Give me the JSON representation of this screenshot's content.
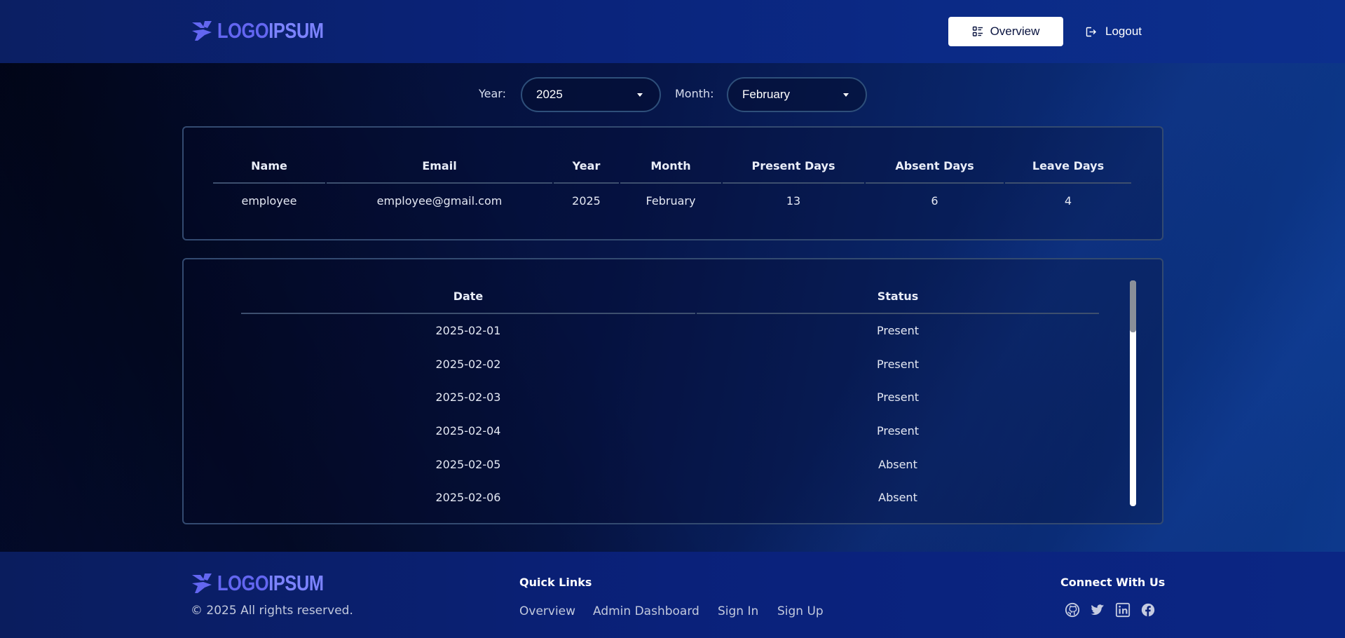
{
  "brand": {
    "logo_text_a": "LOGO",
    "logo_text_b": "IPSUM",
    "accent": "#6366f1"
  },
  "header": {
    "overview_label": "Overview",
    "overview_icon": "list-details-icon",
    "logout_label": "Logout",
    "logout_icon": "logout-icon"
  },
  "filters": {
    "year_label": "Year:",
    "year_value": "2025",
    "month_label": "Month:",
    "month_value": "February"
  },
  "summary": {
    "columns": [
      "Name",
      "Email",
      "Year",
      "Month",
      "Present Days",
      "Absent Days",
      "Leave Days"
    ],
    "row": [
      "employee",
      "employee@gmail.com",
      "2025",
      "February",
      "13",
      "6",
      "4"
    ]
  },
  "attendance": {
    "columns": [
      "Date",
      "Status"
    ],
    "rows": [
      [
        "2025-02-01",
        "Present"
      ],
      [
        "2025-02-02",
        "Present"
      ],
      [
        "2025-02-03",
        "Present"
      ],
      [
        "2025-02-04",
        "Present"
      ],
      [
        "2025-02-05",
        "Absent"
      ],
      [
        "2025-02-06",
        "Absent"
      ],
      [
        "",
        ""
      ]
    ]
  },
  "footer": {
    "copyright": "© 2025 All rights reserved.",
    "quick_links_heading": "Quick Links",
    "quick_links": [
      "Overview",
      "Admin Dashboard",
      "Sign In",
      "Sign Up"
    ],
    "connect_heading": "Connect With Us",
    "social_icons": [
      "github-icon",
      "twitter-icon",
      "linkedin-icon",
      "facebook-icon"
    ]
  }
}
